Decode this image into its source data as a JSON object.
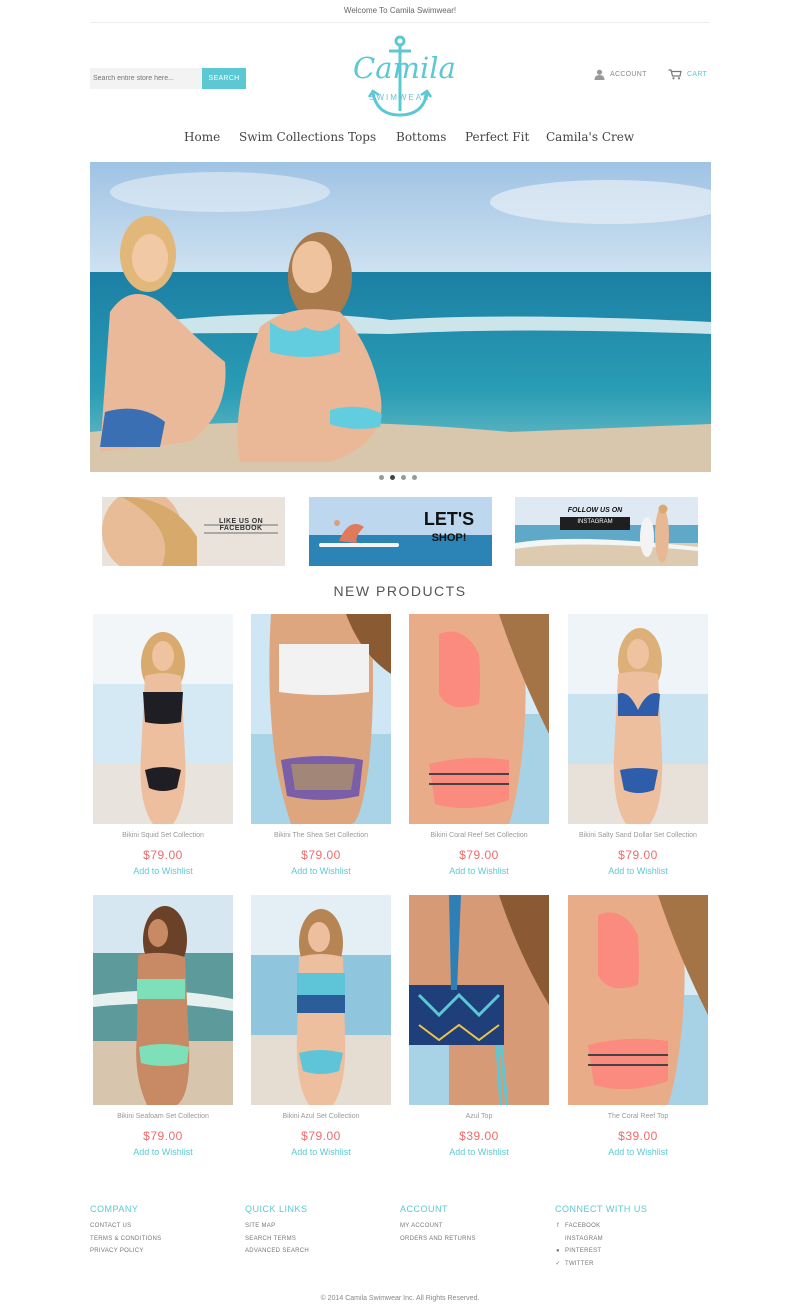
{
  "header": {
    "welcome": "Welcome To Camila Swimwear!",
    "search": {
      "placeholder": "Search entire store here...",
      "button": "SEARCH"
    },
    "logo": {
      "word": "Camila",
      "sub": "SWIMWEAR"
    },
    "account_label": "ACCOUNT",
    "cart_label": "CART",
    "accent_color": "#5cc8d4"
  },
  "nav": {
    "items": [
      {
        "label": "Home"
      },
      {
        "label": "Swim Collections"
      },
      {
        "label": "Tops"
      },
      {
        "label": "Bottoms"
      },
      {
        "label": "Perfect Fit"
      },
      {
        "label": "Camila's Crew"
      }
    ]
  },
  "slider": {
    "slide_count": 4,
    "active_index": 1
  },
  "promos": [
    {
      "text": "LIKE US ON FACEBOOK"
    },
    {
      "text": "LET'S",
      "text2": "SHOP!"
    },
    {
      "text": "FOLLOW US ON",
      "text2": "INSTAGRAM"
    }
  ],
  "products_section": {
    "title": "NEW PRODUCTS",
    "wishlist_label": "Add to Wishlist",
    "items": [
      {
        "name": "Bikini Squid Set Collection",
        "price": "$79.00"
      },
      {
        "name": "Bikini The Shea Set Collection",
        "price": "$79.00"
      },
      {
        "name": "Bikini Coral Reef Set Collection",
        "price": "$79.00"
      },
      {
        "name": "Bikini Salty Sand Dollar Set Collection",
        "price": "$79.00"
      },
      {
        "name": "Bikini Seafoam Set Collection",
        "price": "$79.00"
      },
      {
        "name": "Bikini Azul Set Collection",
        "price": "$79.00"
      },
      {
        "name": "Azul Top",
        "price": "$39.00"
      },
      {
        "name": "The Coral Reef Top",
        "price": "$39.00"
      }
    ]
  },
  "footer": {
    "columns": [
      {
        "title": "COMPANY",
        "links": [
          {
            "label": "CONTACT US"
          },
          {
            "label": "TERMS & CONDITIONS"
          },
          {
            "label": "PRIVACY POLICY"
          }
        ]
      },
      {
        "title": "QUICK LINKS",
        "links": [
          {
            "label": "SITE MAP"
          },
          {
            "label": "SEARCH TERMS"
          },
          {
            "label": "ADVANCED SEARCH"
          }
        ]
      },
      {
        "title": "ACCOUNT",
        "links": [
          {
            "label": "MY ACCOUNT"
          },
          {
            "label": "ORDERS AND RETURNS"
          }
        ]
      },
      {
        "title": "CONNECT WITH US",
        "links": [
          {
            "label": "FACEBOOK",
            "icon": "facebook-icon"
          },
          {
            "label": "INSTAGRAM",
            "icon": "instagram-icon"
          },
          {
            "label": "PINTEREST",
            "icon": "pinterest-icon"
          },
          {
            "label": "TWITTER",
            "icon": "twitter-icon"
          }
        ]
      }
    ],
    "copyright": "© 2014 Camila Swimwear Inc. All Rights Reserved."
  }
}
